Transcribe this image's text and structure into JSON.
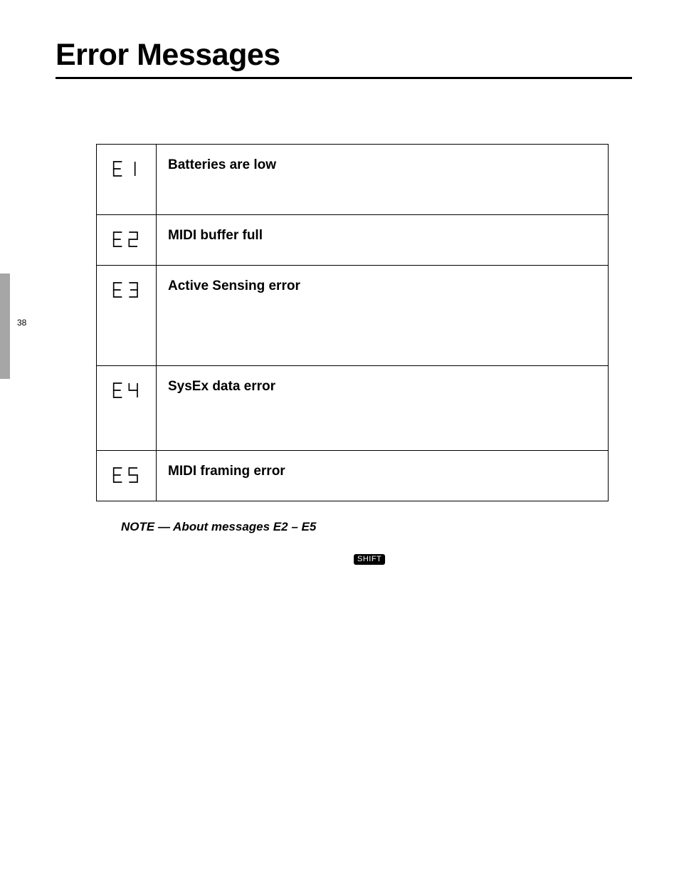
{
  "page": {
    "title": "Error Messages",
    "number": "38"
  },
  "table": {
    "rows": [
      {
        "code": "E1",
        "title": "Batteries are low"
      },
      {
        "code": "E2",
        "title": "MIDI buffer full"
      },
      {
        "code": "E3",
        "title": "Active Sensing error"
      },
      {
        "code": "E4",
        "title": "SysEx data error"
      },
      {
        "code": "E5",
        "title": "MIDI framing error"
      }
    ]
  },
  "note": {
    "title": "NOTE — About messages E2 – E5",
    "shift_label": "SHIFT"
  }
}
